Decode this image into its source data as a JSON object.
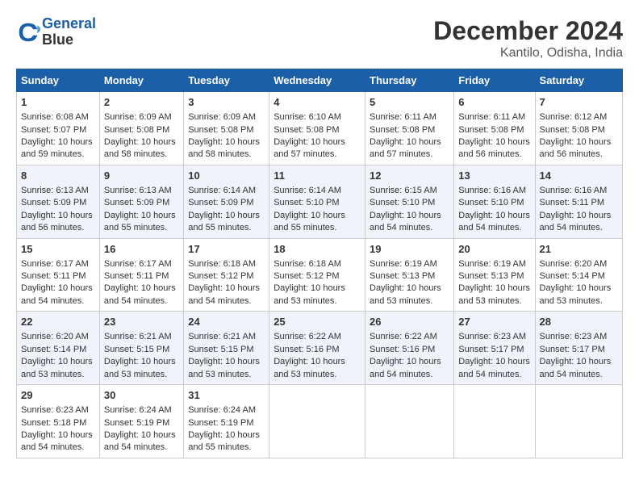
{
  "header": {
    "logo_line1": "General",
    "logo_line2": "Blue",
    "main_title": "December 2024",
    "subtitle": "Kantilo, Odisha, India"
  },
  "days_of_week": [
    "Sunday",
    "Monday",
    "Tuesday",
    "Wednesday",
    "Thursday",
    "Friday",
    "Saturday"
  ],
  "weeks": [
    [
      {
        "day": "1",
        "sunrise": "6:08 AM",
        "sunset": "5:07 PM",
        "daylight": "10 hours and 59 minutes."
      },
      {
        "day": "2",
        "sunrise": "6:09 AM",
        "sunset": "5:08 PM",
        "daylight": "10 hours and 58 minutes."
      },
      {
        "day": "3",
        "sunrise": "6:09 AM",
        "sunset": "5:08 PM",
        "daylight": "10 hours and 58 minutes."
      },
      {
        "day": "4",
        "sunrise": "6:10 AM",
        "sunset": "5:08 PM",
        "daylight": "10 hours and 57 minutes."
      },
      {
        "day": "5",
        "sunrise": "6:11 AM",
        "sunset": "5:08 PM",
        "daylight": "10 hours and 57 minutes."
      },
      {
        "day": "6",
        "sunrise": "6:11 AM",
        "sunset": "5:08 PM",
        "daylight": "10 hours and 56 minutes."
      },
      {
        "day": "7",
        "sunrise": "6:12 AM",
        "sunset": "5:08 PM",
        "daylight": "10 hours and 56 minutes."
      }
    ],
    [
      {
        "day": "8",
        "sunrise": "6:13 AM",
        "sunset": "5:09 PM",
        "daylight": "10 hours and 56 minutes."
      },
      {
        "day": "9",
        "sunrise": "6:13 AM",
        "sunset": "5:09 PM",
        "daylight": "10 hours and 55 minutes."
      },
      {
        "day": "10",
        "sunrise": "6:14 AM",
        "sunset": "5:09 PM",
        "daylight": "10 hours and 55 minutes."
      },
      {
        "day": "11",
        "sunrise": "6:14 AM",
        "sunset": "5:10 PM",
        "daylight": "10 hours and 55 minutes."
      },
      {
        "day": "12",
        "sunrise": "6:15 AM",
        "sunset": "5:10 PM",
        "daylight": "10 hours and 54 minutes."
      },
      {
        "day": "13",
        "sunrise": "6:16 AM",
        "sunset": "5:10 PM",
        "daylight": "10 hours and 54 minutes."
      },
      {
        "day": "14",
        "sunrise": "6:16 AM",
        "sunset": "5:11 PM",
        "daylight": "10 hours and 54 minutes."
      }
    ],
    [
      {
        "day": "15",
        "sunrise": "6:17 AM",
        "sunset": "5:11 PM",
        "daylight": "10 hours and 54 minutes."
      },
      {
        "day": "16",
        "sunrise": "6:17 AM",
        "sunset": "5:11 PM",
        "daylight": "10 hours and 54 minutes."
      },
      {
        "day": "17",
        "sunrise": "6:18 AM",
        "sunset": "5:12 PM",
        "daylight": "10 hours and 54 minutes."
      },
      {
        "day": "18",
        "sunrise": "6:18 AM",
        "sunset": "5:12 PM",
        "daylight": "10 hours and 53 minutes."
      },
      {
        "day": "19",
        "sunrise": "6:19 AM",
        "sunset": "5:13 PM",
        "daylight": "10 hours and 53 minutes."
      },
      {
        "day": "20",
        "sunrise": "6:19 AM",
        "sunset": "5:13 PM",
        "daylight": "10 hours and 53 minutes."
      },
      {
        "day": "21",
        "sunrise": "6:20 AM",
        "sunset": "5:14 PM",
        "daylight": "10 hours and 53 minutes."
      }
    ],
    [
      {
        "day": "22",
        "sunrise": "6:20 AM",
        "sunset": "5:14 PM",
        "daylight": "10 hours and 53 minutes."
      },
      {
        "day": "23",
        "sunrise": "6:21 AM",
        "sunset": "5:15 PM",
        "daylight": "10 hours and 53 minutes."
      },
      {
        "day": "24",
        "sunrise": "6:21 AM",
        "sunset": "5:15 PM",
        "daylight": "10 hours and 53 minutes."
      },
      {
        "day": "25",
        "sunrise": "6:22 AM",
        "sunset": "5:16 PM",
        "daylight": "10 hours and 53 minutes."
      },
      {
        "day": "26",
        "sunrise": "6:22 AM",
        "sunset": "5:16 PM",
        "daylight": "10 hours and 54 minutes."
      },
      {
        "day": "27",
        "sunrise": "6:23 AM",
        "sunset": "5:17 PM",
        "daylight": "10 hours and 54 minutes."
      },
      {
        "day": "28",
        "sunrise": "6:23 AM",
        "sunset": "5:17 PM",
        "daylight": "10 hours and 54 minutes."
      }
    ],
    [
      {
        "day": "29",
        "sunrise": "6:23 AM",
        "sunset": "5:18 PM",
        "daylight": "10 hours and 54 minutes."
      },
      {
        "day": "30",
        "sunrise": "6:24 AM",
        "sunset": "5:19 PM",
        "daylight": "10 hours and 54 minutes."
      },
      {
        "day": "31",
        "sunrise": "6:24 AM",
        "sunset": "5:19 PM",
        "daylight": "10 hours and 55 minutes."
      },
      null,
      null,
      null,
      null
    ]
  ],
  "labels": {
    "sunrise": "Sunrise: ",
    "sunset": "Sunset: ",
    "daylight": "Daylight: "
  }
}
